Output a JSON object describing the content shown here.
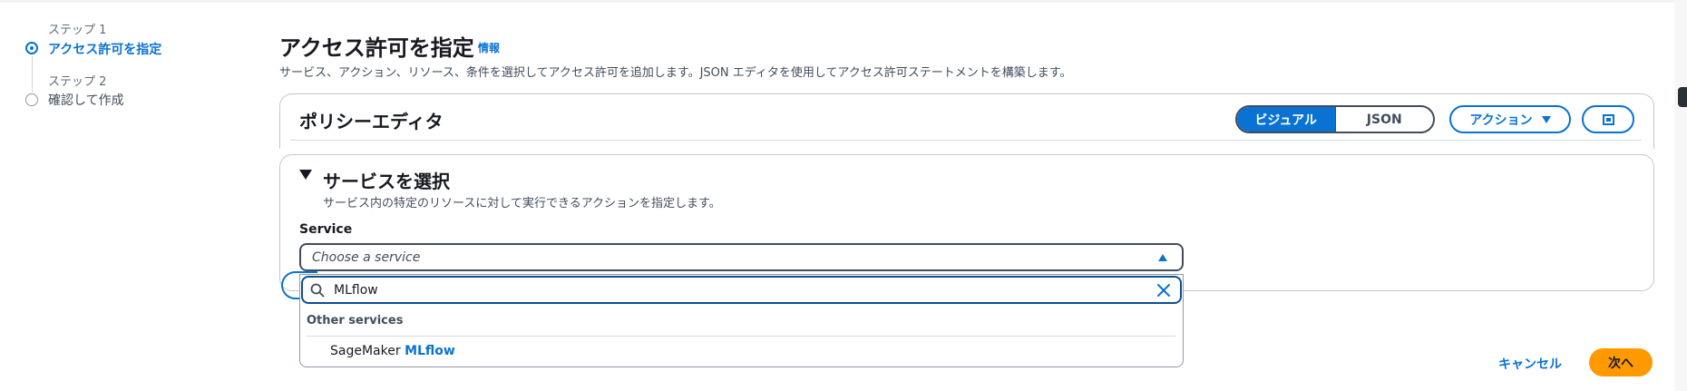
{
  "steps": [
    {
      "step_label": "ステップ 1",
      "title": "アクセス許可を指定",
      "state": "active"
    },
    {
      "step_label": "ステップ 2",
      "title": "確認して作成",
      "state": "inactive"
    }
  ],
  "header": {
    "title": "アクセス許可を指定",
    "info": "情報",
    "description": "サービス、アクション、リソース、条件を選択してアクセス許可を追加します。JSON エディタを使用してアクセス許可ステートメントを構築します。"
  },
  "policy_editor": {
    "title": "ポリシーエディタ",
    "mode_visual": "ビジュアル",
    "mode_json": "JSON",
    "selected_mode": "ビジュアル",
    "actions_label": "アクション",
    "expand_icon": "fullscreen-icon"
  },
  "service_section": {
    "title": "サービスを選択",
    "description": "サービス内の特定のリソースに対して実行できるアクションを指定します。",
    "field_label": "Service",
    "select_placeholder": "Choose a service",
    "search_value": "MLflow",
    "group_label": "Other services",
    "option_prefix": "SageMaker",
    "option_match": "MLflow"
  },
  "footer": {
    "cancel": "キャンセル",
    "next": "次へ"
  },
  "colors": {
    "accent": "#0972d3",
    "primary_button": "#ff9900",
    "text": "#16191f"
  }
}
